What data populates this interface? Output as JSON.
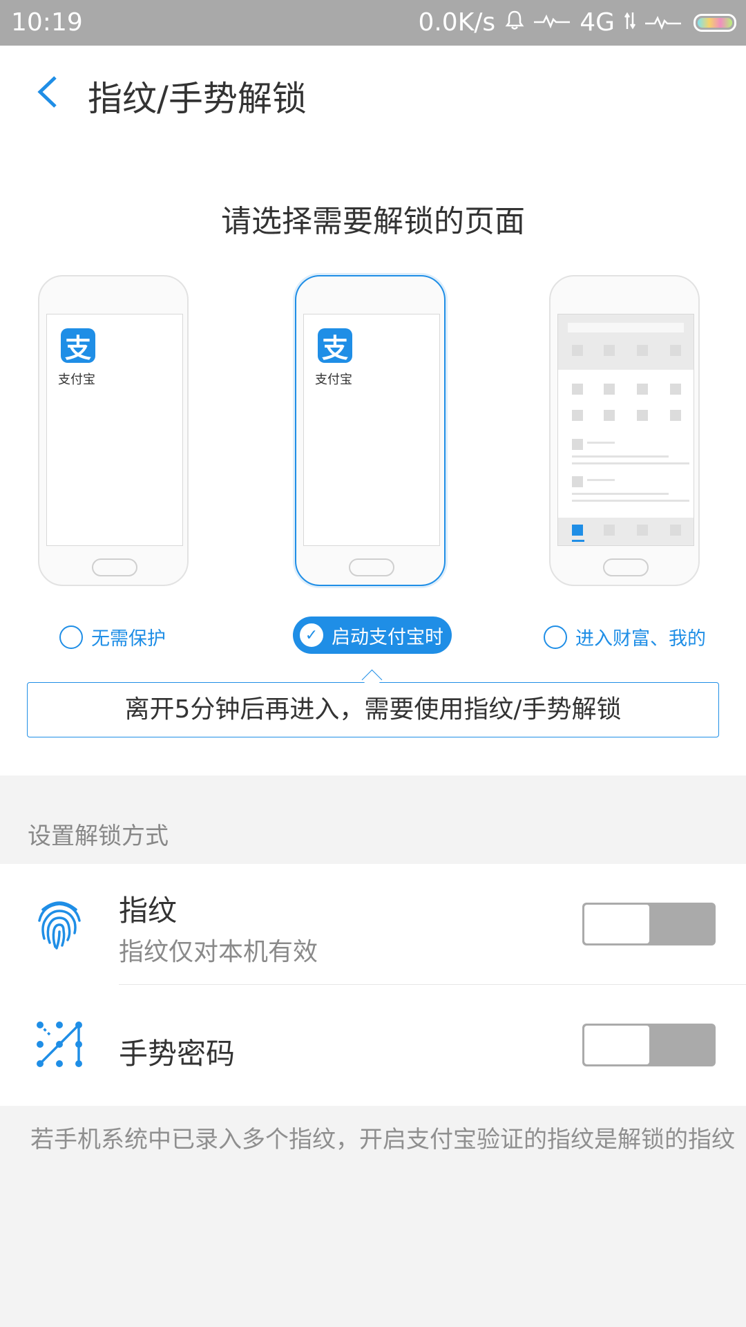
{
  "status_bar": {
    "time": "10:19",
    "net_speed": "0.0K/s",
    "network": "4G",
    "bell_icon": "bell-icon",
    "signal_icon": "signal-wave-icon"
  },
  "header": {
    "title": "指纹/手势解锁",
    "back_icon": "back-arrow-icon"
  },
  "page": {
    "heading": "请选择需要解锁的页面",
    "app_icon_char": "支",
    "app_name": "支付宝",
    "options": [
      {
        "label": "无需保护",
        "selected": false
      },
      {
        "label": "启动支付宝时",
        "selected": true
      },
      {
        "label": "进入财富、我的",
        "selected": false
      }
    ],
    "info_text": "离开5分钟后再进入，需要使用指纹/手势解锁"
  },
  "unlock_methods": {
    "section_title": "设置解锁方式",
    "items": [
      {
        "title": "指纹",
        "subtitle": "指纹仅对本机有效",
        "enabled": false,
        "icon": "fingerprint-icon"
      },
      {
        "title": "手势密码",
        "enabled": false,
        "icon": "gesture-pattern-icon"
      }
    ]
  },
  "footer_note": "若手机系统中已录入多个指纹，开启支付宝验证的指纹是解锁的指纹",
  "colors": {
    "accent": "#1f8ee6",
    "status_bar": "#a9a9a9",
    "toggle_off": "#aaaaaa"
  }
}
